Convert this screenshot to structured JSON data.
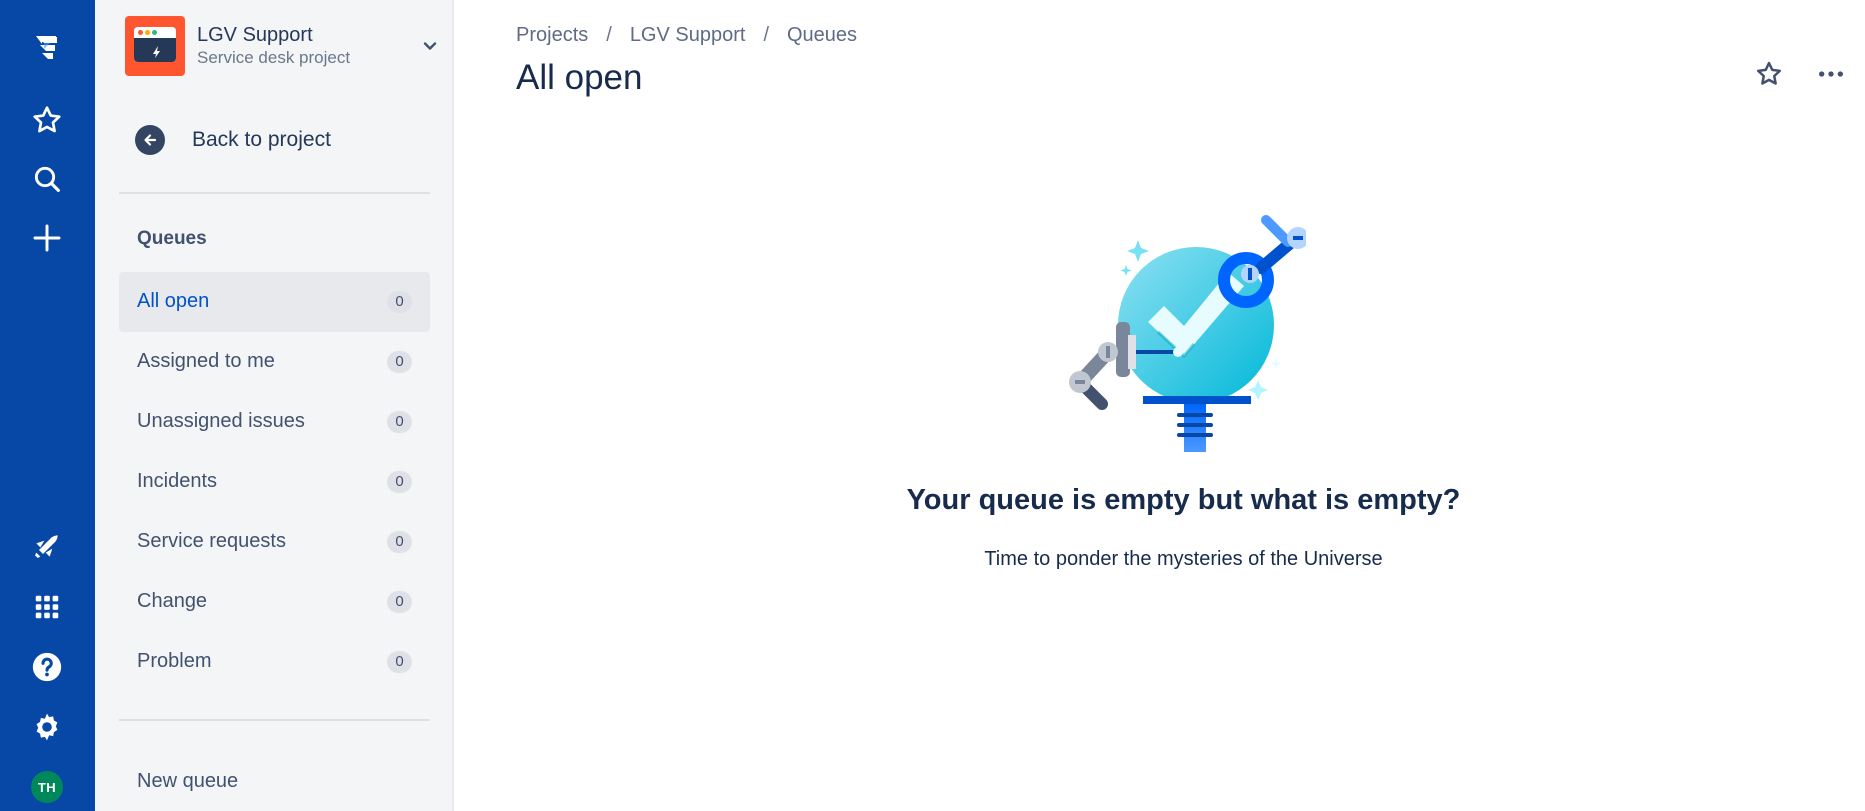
{
  "project": {
    "name": "LGV Support",
    "type": "Service desk project"
  },
  "sidebar": {
    "back_label": "Back to project",
    "section_title": "Queues",
    "queues": [
      {
        "label": "All open",
        "count": "0"
      },
      {
        "label": "Assigned to me",
        "count": "0"
      },
      {
        "label": "Unassigned issues",
        "count": "0"
      },
      {
        "label": "Incidents",
        "count": "0"
      },
      {
        "label": "Service requests",
        "count": "0"
      },
      {
        "label": "Change",
        "count": "0"
      },
      {
        "label": "Problem",
        "count": "0"
      }
    ],
    "new_queue_label": "New queue"
  },
  "global_nav": {
    "icons": [
      "jira-logo-icon",
      "star-icon",
      "search-icon",
      "plus-icon",
      "notification-icon",
      "app-switcher-icon",
      "help-icon",
      "settings-icon"
    ],
    "avatar_initials": "TH",
    "avatar_color": "#00875a",
    "nav_color": "#0747a6"
  },
  "breadcrumb": [
    "Projects",
    "LGV Support",
    "Queues"
  ],
  "page": {
    "title": "All open"
  },
  "empty_state": {
    "title": "Your queue is empty but what is empty?",
    "subtitle": "Time to ponder the mysteries of the Universe"
  },
  "colors": {
    "active_link": "#0052cc",
    "sidebar_bg": "#f4f5f7",
    "project_avatar": "#ff5630"
  }
}
